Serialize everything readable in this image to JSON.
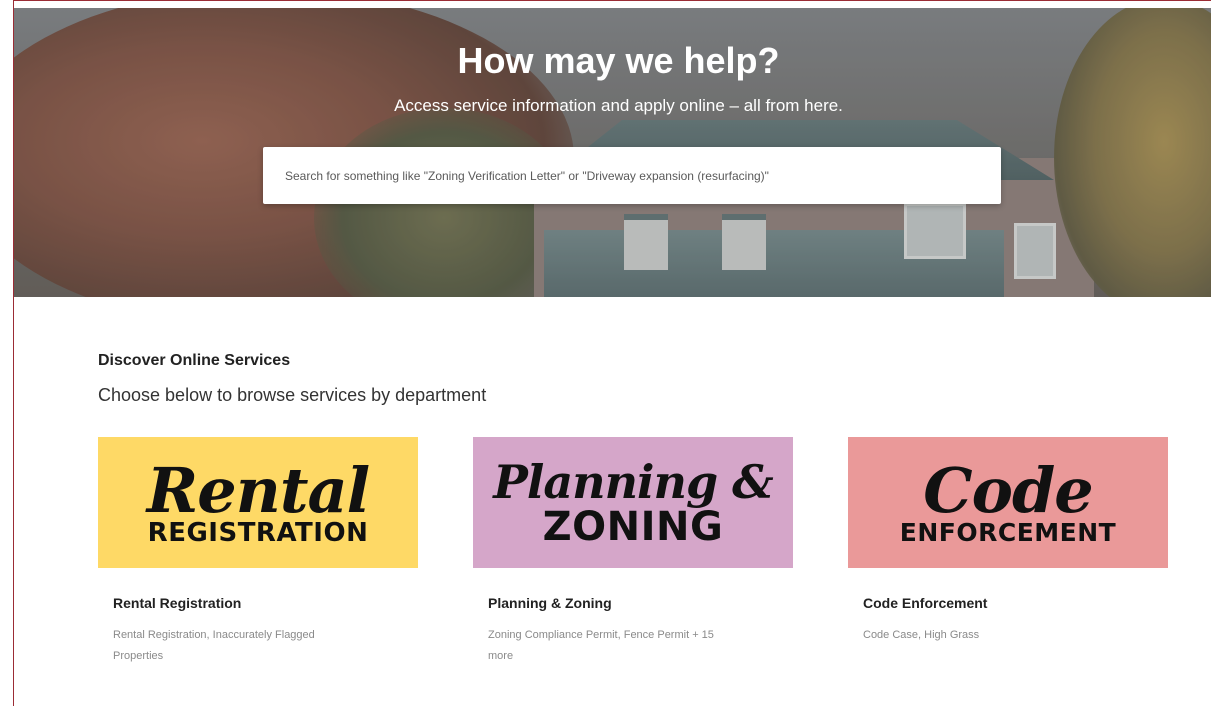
{
  "hero": {
    "title": "How may we help?",
    "subtitle": "Access service information and apply online – all from here.",
    "search_placeholder": "Search for something like \"Zoning Verification Letter\" or \"Driveway expansion (resurfacing)\""
  },
  "discover": {
    "heading": "Discover Online Services",
    "subheading": "Choose below to browse services by department"
  },
  "cards": [
    {
      "image_script": "Rental",
      "image_block": "REGISTRATION",
      "bg_color": "#fed966",
      "title": "Rental Registration",
      "description": "Rental Registration, Inaccurately Flagged Properties"
    },
    {
      "image_script": "Planning &",
      "image_block": "ZONING",
      "bg_color": "#d5a6c9",
      "title": "Planning & Zoning",
      "description": "Zoning Compliance Permit, Fence Permit + 15 more"
    },
    {
      "image_script": "Code",
      "image_block": "ENFORCEMENT",
      "bg_color": "#ea9999",
      "title": "Code Enforcement",
      "description": "Code Case, High Grass"
    }
  ],
  "colors": {
    "frame_border": "#9b2c35"
  }
}
